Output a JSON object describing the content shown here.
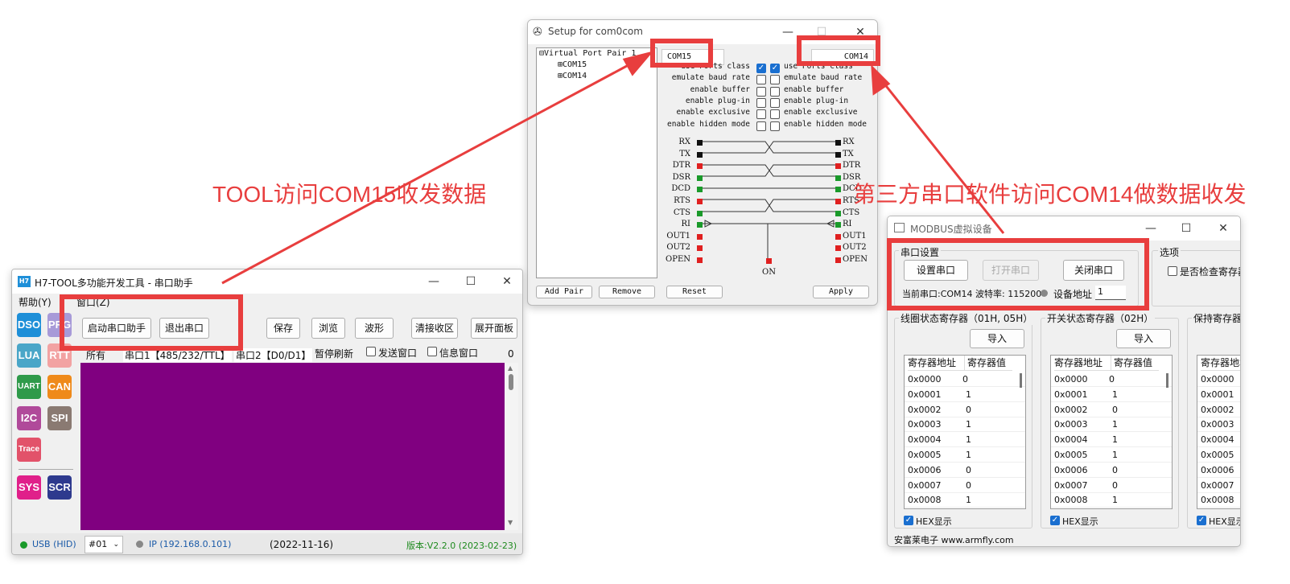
{
  "colors": {
    "accent_red": "#e83e3e",
    "purple": "#800080",
    "green_text": "#1e8a1e",
    "checkbox_blue": "#1a6fd0"
  },
  "annotations": {
    "left": "TOOL访问COM15收发数据",
    "right": "第三方串口软件访问COM14做数据收发"
  },
  "com0com": {
    "title": "Setup for com0com",
    "tree": {
      "root": "Virtual Port Pair 1",
      "child1": "COM15",
      "child2": "COM14"
    },
    "portA": "COM15",
    "portB": "COM14",
    "options_left": [
      "use Ports class",
      "emulate baud rate",
      "enable buffer",
      "enable plug-in",
      "enable exclusive",
      "enable hidden mode"
    ],
    "options_right": [
      "use Ports class",
      "emulate baud rate",
      "enable buffer",
      "enable plug-in",
      "enable exclusive",
      "enable hidden mode"
    ],
    "options_checked": [
      true,
      false,
      false,
      false,
      false,
      false
    ],
    "signals_left": [
      "RX",
      "TX",
      "DTR",
      "DSR",
      "DCD",
      "RTS",
      "CTS",
      "RI",
      "OUT1",
      "OUT2",
      "OPEN"
    ],
    "signals_right": [
      "RX",
      "TX",
      "DTR",
      "DSR",
      "DCD",
      "RTS",
      "CTS",
      "RI",
      "OUT1",
      "OUT2",
      "OPEN"
    ],
    "signal_colors": [
      "black",
      "black",
      "red",
      "green",
      "green",
      "red",
      "green",
      "green",
      "red",
      "red",
      "red"
    ],
    "on_label": "ON",
    "buttons": {
      "add": "Add Pair",
      "remove": "Remove",
      "reset": "Reset",
      "apply": "Apply"
    }
  },
  "h7": {
    "title": "H7-TOOL多功能开发工具 - 串口助手",
    "icon": "H7",
    "menu": [
      "帮助(Y)",
      "窗口(Z)"
    ],
    "tiles": [
      {
        "label": "DSO",
        "color": "#1e8fd8"
      },
      {
        "label": "PRG",
        "color": "#a79ad8"
      },
      {
        "label": "LUA",
        "color": "#4aa6c8"
      },
      {
        "label": "RTT",
        "color": "#f2a2a2"
      },
      {
        "label": "UART",
        "color": "#2f9a4a"
      },
      {
        "label": "CAN",
        "color": "#ef8a1a"
      },
      {
        "label": "I2C",
        "color": "#b04a9a"
      },
      {
        "label": "SPI",
        "color": "#8a7a72"
      },
      {
        "label": "Trace",
        "color": "#e2526a"
      },
      {
        "label": "SYS",
        "color": "#e0208a"
      },
      {
        "label": "SCR",
        "color": "#2e3a8e"
      }
    ],
    "buttons": {
      "start": "启动串口助手",
      "exit": "退出串口",
      "save": "保存",
      "browse": "浏览",
      "wave": "波形",
      "clear": "清接收区",
      "expand": "展开面板"
    },
    "filter": {
      "all": "所有",
      "port1": "串口1【485/232/TTL】",
      "port2": "串口2【D0/D1】",
      "pause": "暂停刷新",
      "send_window": "发送窗口",
      "info_window": "信息窗口",
      "count": "0"
    },
    "status": {
      "usb": "USB (HID)",
      "device": "#01",
      "ip": "IP (192.168.0.101)",
      "date": "(2022-11-16)",
      "version": "版本:V2.2.0 (2023-02-23)"
    }
  },
  "modbus": {
    "title": "MODBUS虚拟设备",
    "serial_group": "串口设置",
    "options_group": "选项",
    "buttons": {
      "setup": "设置串口",
      "open": "打开串口",
      "close": "关闭串口"
    },
    "status_text": "当前串口:COM14 波特率: 115200",
    "addr_label": "设备地址",
    "addr_value": "1",
    "check_register": "是否检查寄存器",
    "groups": [
      {
        "title": "线圈状态寄存器（01H, 05H）",
        "import": "导入",
        "col1": "寄存器地址",
        "col2": "寄存器值",
        "addrs": [
          "0x0000",
          "0x0001",
          "0x0002",
          "0x0003",
          "0x0004",
          "0x0005",
          "0x0006",
          "0x0007",
          "0x0008"
        ],
        "values": [
          "0",
          "1",
          "0",
          "1",
          "1",
          "1",
          "0",
          "0",
          "1"
        ],
        "hex": "HEX显示"
      },
      {
        "title": "开关状态寄存器（02H）",
        "import": "导入",
        "col1": "寄存器地址",
        "col2": "寄存器值",
        "addrs": [
          "0x0000",
          "0x0001",
          "0x0002",
          "0x0003",
          "0x0004",
          "0x0005",
          "0x0006",
          "0x0007",
          "0x0008"
        ],
        "values": [
          "0",
          "1",
          "0",
          "1",
          "1",
          "1",
          "0",
          "0",
          "1"
        ],
        "hex": "HEX显示"
      },
      {
        "title": "保持寄存器",
        "col1": "寄存器地址",
        "addrs": [
          "0x0000",
          "0x0001",
          "0x0002",
          "0x0003",
          "0x0004",
          "0x0005",
          "0x0006",
          "0x0007",
          "0x0008"
        ],
        "hex": "HEX显示"
      }
    ],
    "footer": "安富莱电子 www.armfly.com"
  }
}
